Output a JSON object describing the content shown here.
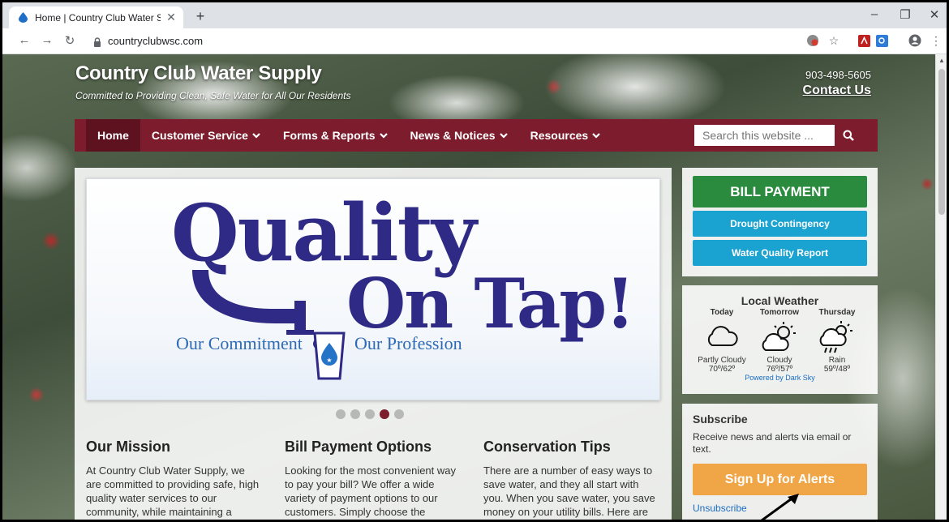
{
  "browser": {
    "tab_title": "Home | Country Club Water Supp",
    "tab_close": "✕",
    "new_tab": "+",
    "url": "countryclubwsc.com",
    "window_controls": {
      "minimize": "–",
      "restore": "❐",
      "close": "✕"
    }
  },
  "header": {
    "site_title": "Country Club Water Supply",
    "tagline": "Committed to Providing Clean, Safe Water for All Our Residents",
    "phone": "903-498-5605",
    "contact_label": "Contact Us"
  },
  "nav": {
    "items": [
      {
        "label": "Home"
      },
      {
        "label": "Customer Service"
      },
      {
        "label": "Forms & Reports"
      },
      {
        "label": "News & Notices"
      },
      {
        "label": "Resources"
      }
    ],
    "search_placeholder": "Search this website ..."
  },
  "slider": {
    "line1": "Quality",
    "line2": "On Tap!",
    "left_sub": "Our Commitment",
    "right_sub": "Our Profession",
    "dots": 5,
    "active_dot": 4
  },
  "columns": [
    {
      "title": "Our Mission",
      "text": "At Country Club Water Supply, we are committed to providing safe, high quality water services to our community, while maintaining a"
    },
    {
      "title": "Bill Payment Options",
      "text": "Looking for the most convenient way to pay your bill? We offer a wide variety of payment options to our customers. Simply choose the"
    },
    {
      "title": "Conservation Tips",
      "text": "There are a number of easy ways to save water, and they all start with you. When you save water, you save money on your utility bills. Here are"
    }
  ],
  "sidebar": {
    "bill_payment": "BILL PAYMENT",
    "drought": "Drought Contingency",
    "water_quality": "Water Quality Report",
    "weather": {
      "title": "Local Weather",
      "days": [
        {
          "day": "Today",
          "icon": "partly-cloudy-icon",
          "condition": "Partly Cloudy",
          "temp": "70º/62º"
        },
        {
          "day": "Tomorrow",
          "icon": "cloudy-icon",
          "condition": "Cloudy",
          "temp": "76º/57º"
        },
        {
          "day": "Thursday",
          "icon": "rain-icon",
          "condition": "Rain",
          "temp": "59º/48º"
        }
      ],
      "powered": "Powered by Dark Sky"
    },
    "subscribe": {
      "title": "Subscribe",
      "text": "Receive news and alerts via email or text.",
      "button": "Sign Up for Alerts",
      "unsubscribe": "Unsubscribe"
    }
  },
  "colors": {
    "nav_bg": "#7d1c2c",
    "nav_active": "#5e111f",
    "green": "#2a8a3e",
    "blue": "#1aa2d1",
    "orange": "#f0a646",
    "logo_navy": "#2e2a85"
  }
}
